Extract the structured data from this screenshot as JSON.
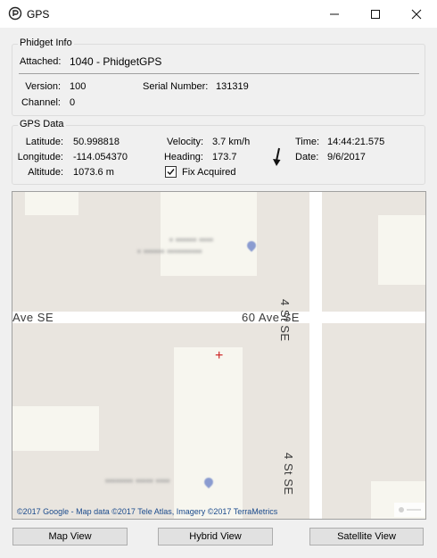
{
  "window": {
    "title": "GPS"
  },
  "phidget_info": {
    "group_title": "Phidget Info",
    "attached_label": "Attached:",
    "attached_value": "1040 - PhidgetGPS",
    "version_label": "Version:",
    "version_value": "100",
    "serial_label": "Serial Number:",
    "serial_value": "131319",
    "channel_label": "Channel:",
    "channel_value": "0"
  },
  "gps_data": {
    "group_title": "GPS Data",
    "latitude_label": "Latitude:",
    "latitude_value": "50.998818",
    "longitude_label": "Longitude:",
    "longitude_value": "-114.054370",
    "altitude_label": "Altitude:",
    "altitude_value": "1073.6 m",
    "velocity_label": "Velocity:",
    "velocity_value": "3.7 km/h",
    "heading_label": "Heading:",
    "heading_value": "173.7",
    "fix_label": "Fix Acquired",
    "fix_checked": true,
    "time_label": "Time:",
    "time_value": "14:44:21.575",
    "date_label": "Date:",
    "date_value": "9/6/2017"
  },
  "map": {
    "road_60ave_left": "Ave SE",
    "road_60ave_center": "60 Ave SE",
    "road_4st_top": "4 St SE",
    "road_4st_bottom": "4 St SE",
    "copyright": "©2017 Google - Map data ©2017 Tele Atlas, Imagery ©2017 TerraMetrics"
  },
  "buttons": {
    "map_view": "Map View",
    "hybrid_view": "Hybrid View",
    "satellite_view": "Satellite View"
  }
}
